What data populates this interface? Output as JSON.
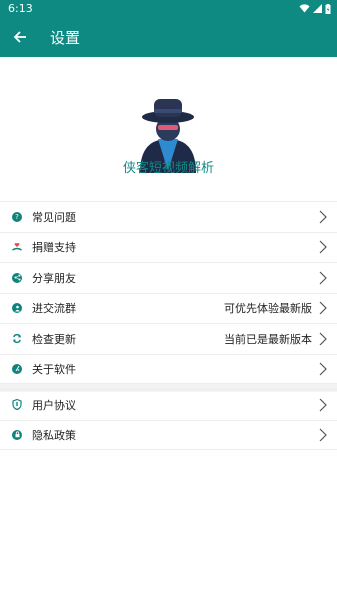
{
  "status_bar": {
    "time": "6:13"
  },
  "toolbar": {
    "title": "设置"
  },
  "app": {
    "name": "侠客短视频解析"
  },
  "menu_group1": [
    {
      "label": "常见问题",
      "value": "",
      "icon": "question-icon"
    },
    {
      "label": "捐赠支持",
      "value": "",
      "icon": "donate-icon"
    },
    {
      "label": "分享朋友",
      "value": "",
      "icon": "share-icon"
    },
    {
      "label": "进交流群",
      "value": "可优先体验最新版",
      "icon": "group-icon"
    },
    {
      "label": "检查更新",
      "value": "当前已是最新版本",
      "icon": "refresh-icon"
    },
    {
      "label": "关于软件",
      "value": "",
      "icon": "info-icon"
    }
  ],
  "menu_group2": [
    {
      "label": "用户协议",
      "value": "",
      "icon": "shield-icon"
    },
    {
      "label": "隐私政策",
      "value": "",
      "icon": "privacy-icon"
    }
  ],
  "colors": {
    "primary": "#0f8a82",
    "accent_text": "#118a84",
    "icon": "#11837c"
  }
}
